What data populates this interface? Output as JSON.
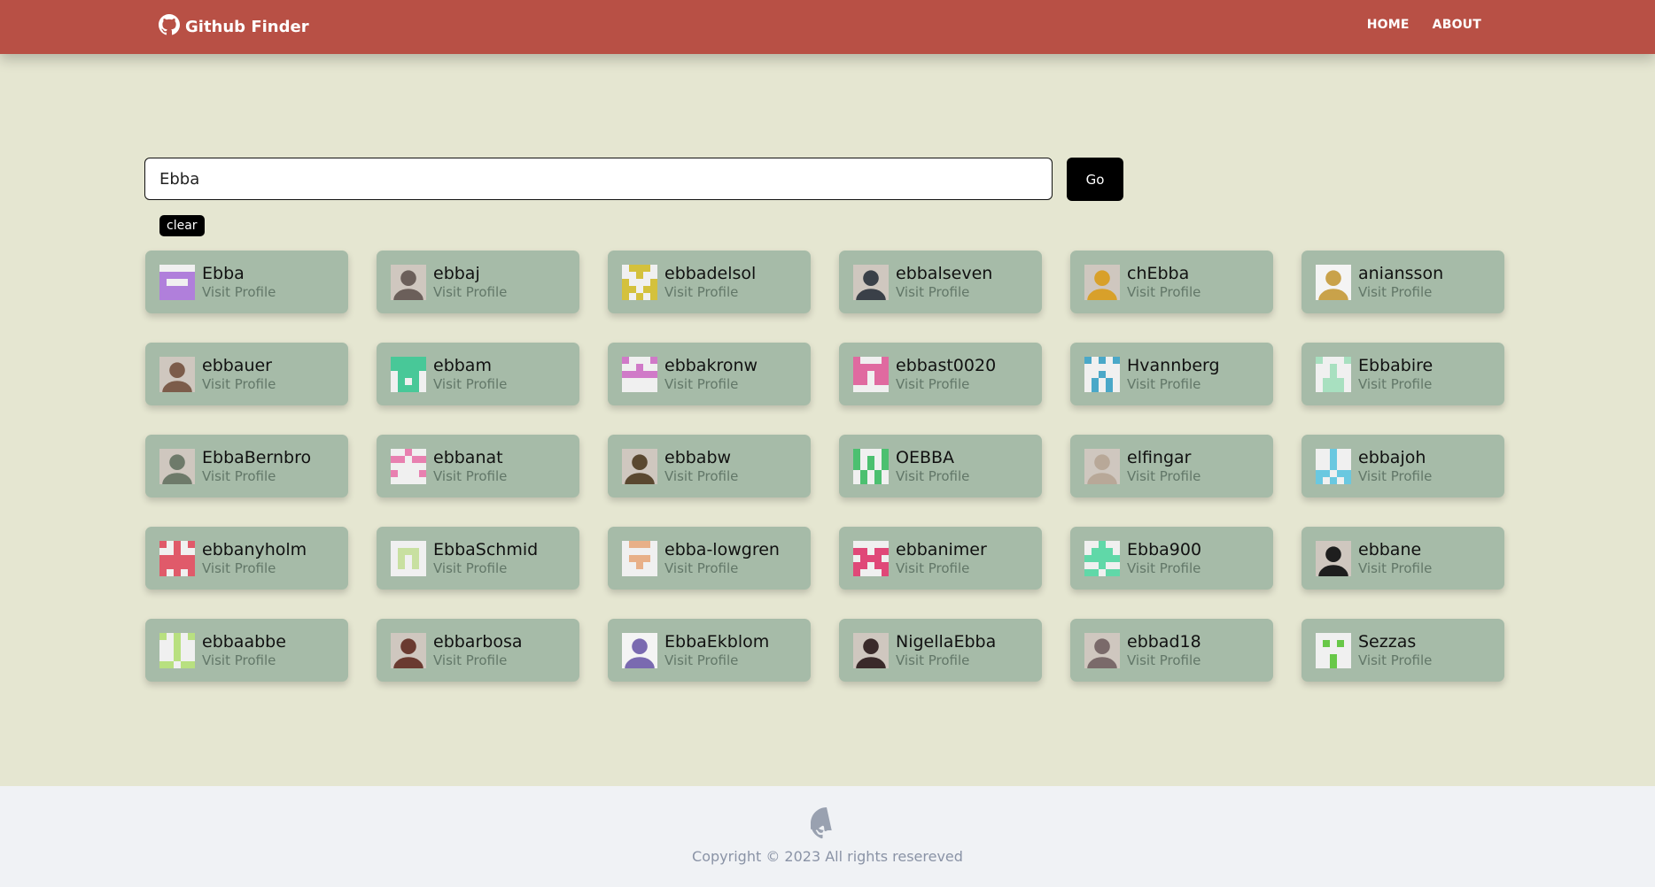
{
  "navbar": {
    "brand_icon": "github-icon",
    "brand": "Github Finder",
    "links": [
      "HOME",
      "ABOUT"
    ]
  },
  "search": {
    "value": "Ebba",
    "go_label": "Go",
    "clear_label": "clear"
  },
  "visit_label": "Visit Profile",
  "users": [
    {
      "login": "Ebba",
      "avatar": "identicon",
      "color": "#b07fdb"
    },
    {
      "login": "ebbaj",
      "avatar": "photo",
      "color": "#6b5f5a"
    },
    {
      "login": "ebbadelsol",
      "avatar": "identicon",
      "color": "#d4c13c"
    },
    {
      "login": "ebbalseven",
      "avatar": "photo",
      "color": "#3a4048"
    },
    {
      "login": "chEbba",
      "avatar": "photo",
      "color": "#d8a02a"
    },
    {
      "login": "aniansson",
      "avatar": "cartoon",
      "color": "#c9a24a"
    },
    {
      "login": "ebbauer",
      "avatar": "photo",
      "color": "#7c5c4a"
    },
    {
      "login": "ebbam",
      "avatar": "identicon",
      "color": "#48c898"
    },
    {
      "login": "ebbakronw",
      "avatar": "identicon",
      "color": "#d07ac8"
    },
    {
      "login": "ebbast0020",
      "avatar": "identicon",
      "color": "#e06aa0"
    },
    {
      "login": "Hvannberg",
      "avatar": "identicon",
      "color": "#4aa8c8"
    },
    {
      "login": "Ebbabire",
      "avatar": "identicon",
      "color": "#a8e0c0"
    },
    {
      "login": "EbbaBernbro",
      "avatar": "photo",
      "color": "#6e7a6a"
    },
    {
      "login": "ebbanat",
      "avatar": "identicon",
      "color": "#e880b0"
    },
    {
      "login": "ebbabw",
      "avatar": "photo",
      "color": "#5a4830"
    },
    {
      "login": "OEBBA",
      "avatar": "identicon",
      "color": "#4cc070"
    },
    {
      "login": "elfingar",
      "avatar": "photo",
      "color": "#b8a898"
    },
    {
      "login": "ebbajoh",
      "avatar": "identicon",
      "color": "#6ac8e0"
    },
    {
      "login": "ebbanyholm",
      "avatar": "identicon",
      "color": "#e05a6a"
    },
    {
      "login": "EbbaSchmid",
      "avatar": "identicon",
      "color": "#c8e0a0"
    },
    {
      "login": "ebba-lowgren",
      "avatar": "identicon",
      "color": "#e8b088"
    },
    {
      "login": "ebbanimer",
      "avatar": "identicon",
      "color": "#e04878"
    },
    {
      "login": "Ebba900",
      "avatar": "identicon",
      "color": "#60d8a8"
    },
    {
      "login": "ebbane",
      "avatar": "photo",
      "color": "#1e1e1e"
    },
    {
      "login": "ebbaabbe",
      "avatar": "identicon",
      "color": "#b8e080"
    },
    {
      "login": "ebbarbosa",
      "avatar": "photo",
      "color": "#6a3a30"
    },
    {
      "login": "EbbaEkblom",
      "avatar": "cartoon",
      "color": "#7a6ab0"
    },
    {
      "login": "NigellaEbba",
      "avatar": "photo",
      "color": "#3a2a2a"
    },
    {
      "login": "ebbad18",
      "avatar": "photo",
      "color": "#7a6a6a"
    },
    {
      "login": "Sezzas",
      "avatar": "identicon",
      "color": "#68c848"
    }
  ],
  "footer": {
    "icon": "github-icon",
    "copyright": "Copyright © 2023 All rights resereved"
  }
}
